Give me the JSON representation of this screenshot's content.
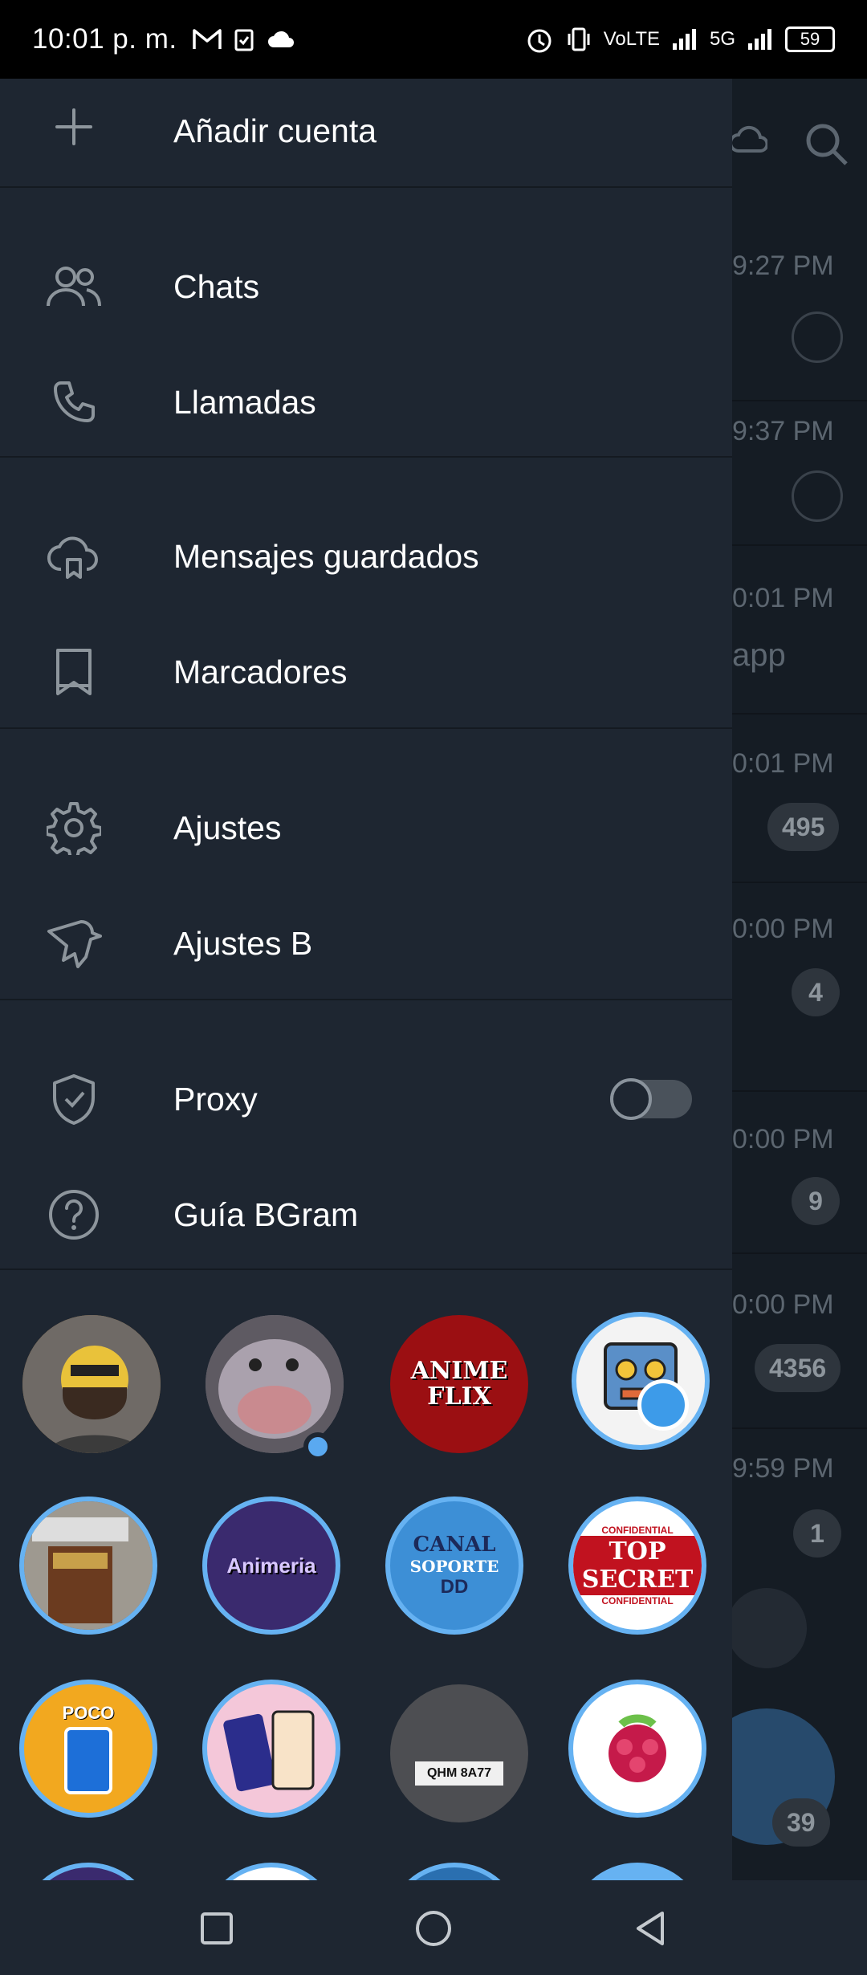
{
  "status_bar": {
    "time": "10:01 p. m.",
    "network_label": "VoLTE",
    "network_type": "5G",
    "battery": "59"
  },
  "background": {
    "times": [
      "9:27 PM",
      "9:37 PM",
      "0:01 PM",
      "0:01 PM",
      "0:00 PM",
      "0:00 PM",
      "0:00 PM",
      "9:59 PM"
    ],
    "snippet": "app",
    "badges": [
      "495",
      "4",
      "9",
      "4356",
      "1",
      "39"
    ]
  },
  "drawer": {
    "add_account": "Añadir cuenta",
    "items": {
      "chats": "Chats",
      "calls": "Llamadas",
      "saved_messages": "Mensajes guardados",
      "bookmarks": "Marcadores",
      "settings": "Ajustes",
      "settings_b": "Ajustes B",
      "proxy": "Proxy",
      "guide": "Guía BGram"
    },
    "proxy_enabled": false,
    "avatar_texts": {
      "animeflix": "ANIME FLIX",
      "animeria": "Animeria",
      "canal": "CANAL",
      "soporte": "SOPORTE",
      "dd": "DD",
      "top_secret": "TOP SECRET",
      "confidential": "CONFIDENTIAL",
      "poco": "POCO",
      "plate": "QHM 8A77"
    }
  },
  "colors": {
    "drawer_bg": "#1e2631",
    "accent": "#66b2f2",
    "background_list": "#151c24"
  }
}
